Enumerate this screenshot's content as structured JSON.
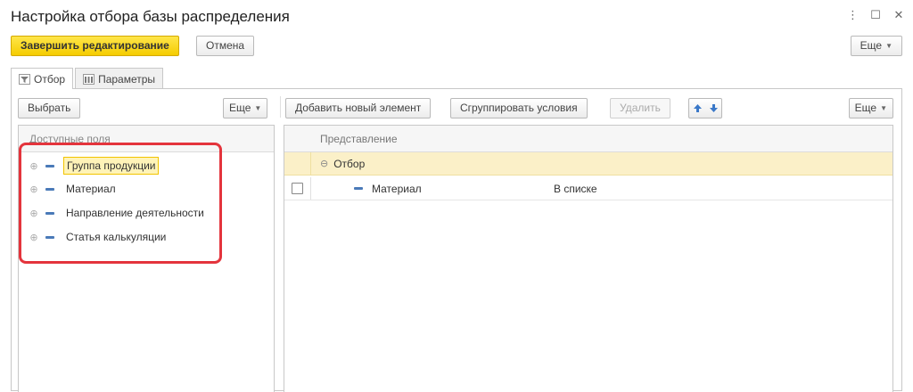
{
  "window": {
    "title": "Настройка отбора базы распределения",
    "controls": {
      "more": "⋮",
      "maximize": "☐",
      "close": "✕"
    }
  },
  "toolbar": {
    "finish_label": "Завершить редактирование",
    "cancel_label": "Отмена",
    "more_label": "Еще"
  },
  "tabs": [
    {
      "label": "Отбор",
      "icon": "filter-icon",
      "active": true
    },
    {
      "label": "Параметры",
      "icon": "parameters-icon",
      "active": false
    }
  ],
  "left_panel": {
    "select_label": "Выбрать",
    "more_label": "Еще",
    "header": "Доступные поля",
    "items": [
      {
        "label": "Группа продукции",
        "selected": true
      },
      {
        "label": "Материал",
        "selected": false
      },
      {
        "label": "Направление деятельности",
        "selected": false
      },
      {
        "label": "Статья калькуляции",
        "selected": false
      }
    ]
  },
  "right_panel": {
    "add_label": "Добавить новый элемент",
    "group_label": "Сгруппировать условия",
    "delete_label": "Удалить",
    "more_label": "Еще",
    "header": "Представление",
    "group_row": "Отбор",
    "item_row": {
      "label": "Материал",
      "condition": "В списке",
      "checked": false
    }
  },
  "colors": {
    "primary_button": "#f5cc00",
    "group_row": "#fbf0c8",
    "highlight_frame": "#e4343c",
    "arrow_blue": "#3a78c8"
  }
}
